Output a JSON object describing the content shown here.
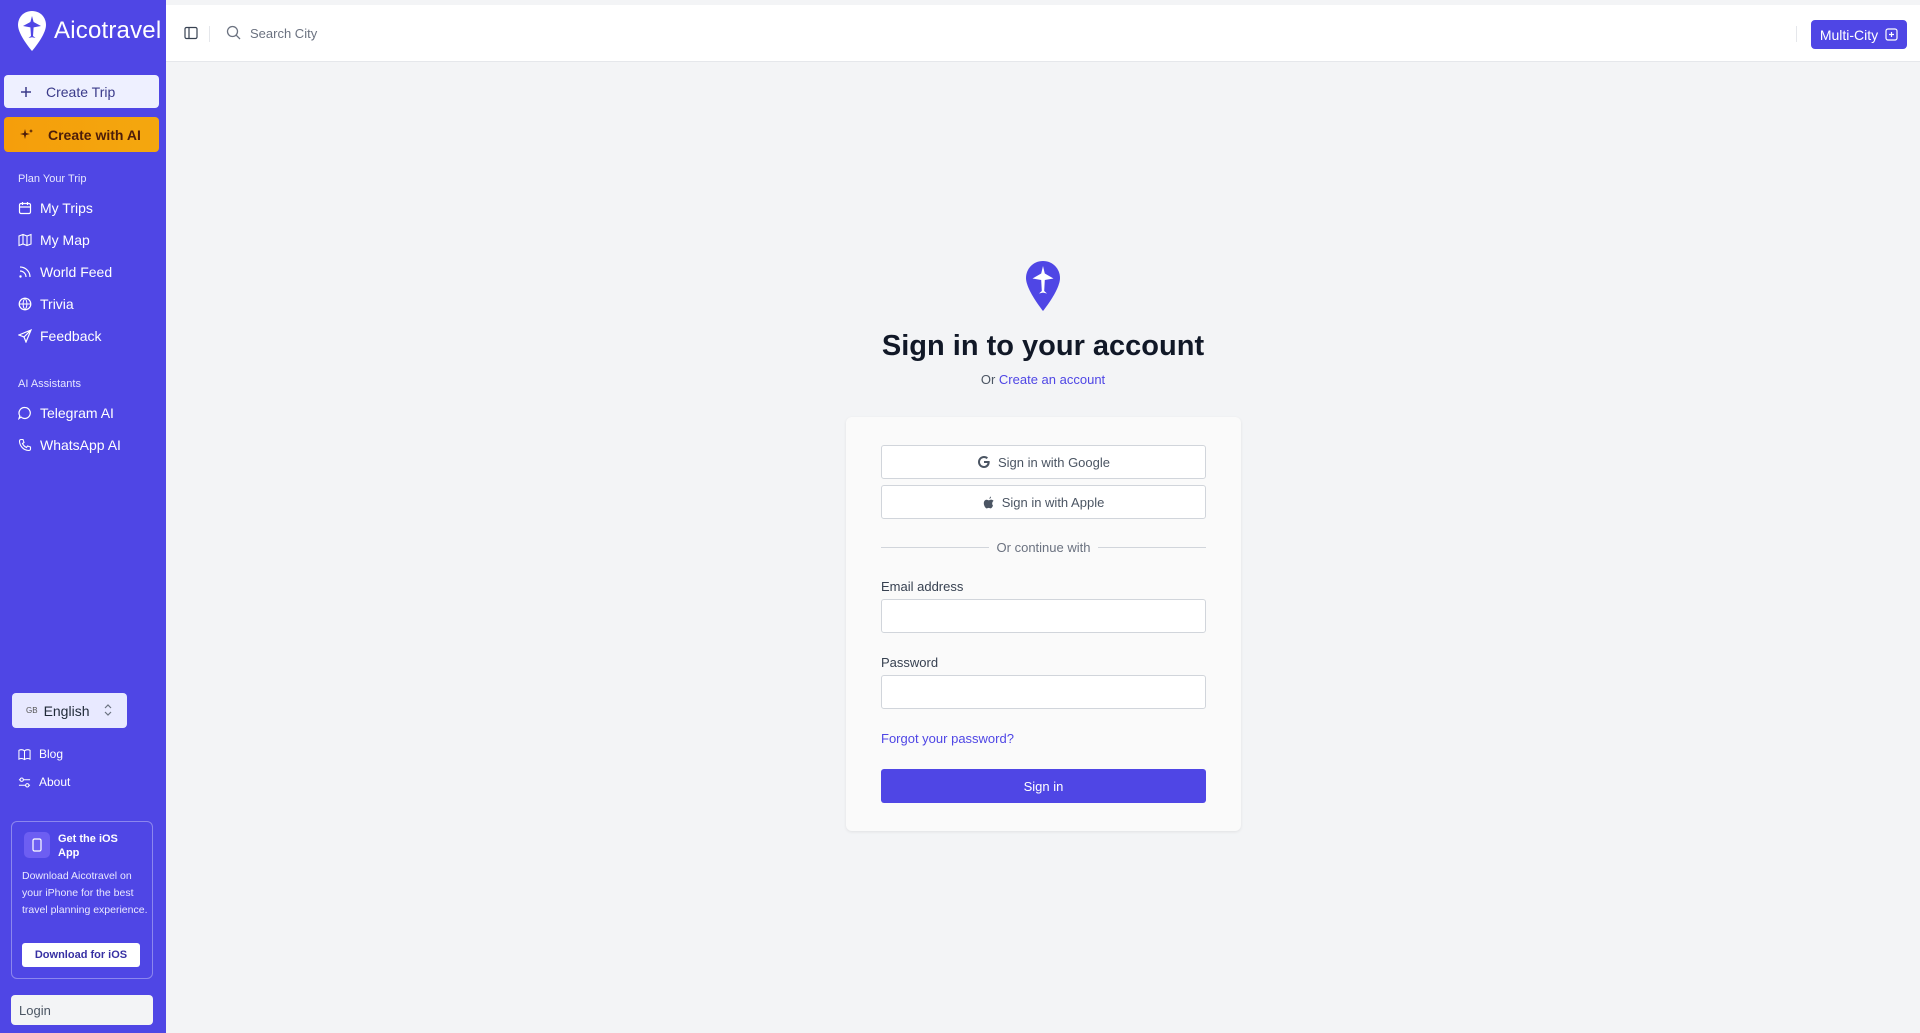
{
  "app": {
    "name": "Aicotravel"
  },
  "sidebar": {
    "create_trip": "Create Trip",
    "create_with_ai": "Create with AI",
    "plan_section": "Plan Your Trip",
    "plan_items": [
      "My Trips",
      "My Map",
      "World Feed",
      "Trivia",
      "Feedback"
    ],
    "ai_section": "AI Assistants",
    "ai_items": [
      "Telegram AI",
      "WhatsApp AI"
    ],
    "language": {
      "flag": "GB",
      "label": "English"
    },
    "footer_links": [
      "Blog",
      "About"
    ],
    "ios_card": {
      "title": "Get the iOS App",
      "description": "Download Aicotravel on your iPhone for the best travel planning experience.",
      "button": "Download for iOS"
    },
    "login": "Login"
  },
  "topbar": {
    "search_placeholder": "Search City",
    "multi_city": "Multi-City"
  },
  "signin": {
    "title": "Sign in to your account",
    "or_prefix": "Or",
    "create_account_link": "Create an account",
    "google_button": "Sign in with Google",
    "apple_button": "Sign in with Apple",
    "divider": "Or continue with",
    "email_label": "Email address",
    "email_value": "",
    "password_label": "Password",
    "password_value": "",
    "forgot_link": "Forgot your password?",
    "submit": "Sign in"
  },
  "colors": {
    "primary": "#4f46e5",
    "ai_accent": "#f59e0b",
    "background": "#f3f4f6"
  },
  "icons": {
    "logo": "plane-pin-icon",
    "create_trip": "plus-icon",
    "create_ai": "sparkles-icon",
    "my_trips": "calendar-icon",
    "my_map": "map-icon",
    "world_feed": "rss-icon",
    "trivia": "globe-icon",
    "feedback": "send-icon",
    "telegram": "message-circle-icon",
    "whatsapp": "phone-icon",
    "blog": "book-icon",
    "about": "sliders-icon",
    "ios": "smartphone-icon",
    "search": "search-icon",
    "sidebar_toggle": "panel-left-icon",
    "multi_city": "plus-square-icon",
    "google": "google-icon",
    "apple": "apple-icon"
  }
}
